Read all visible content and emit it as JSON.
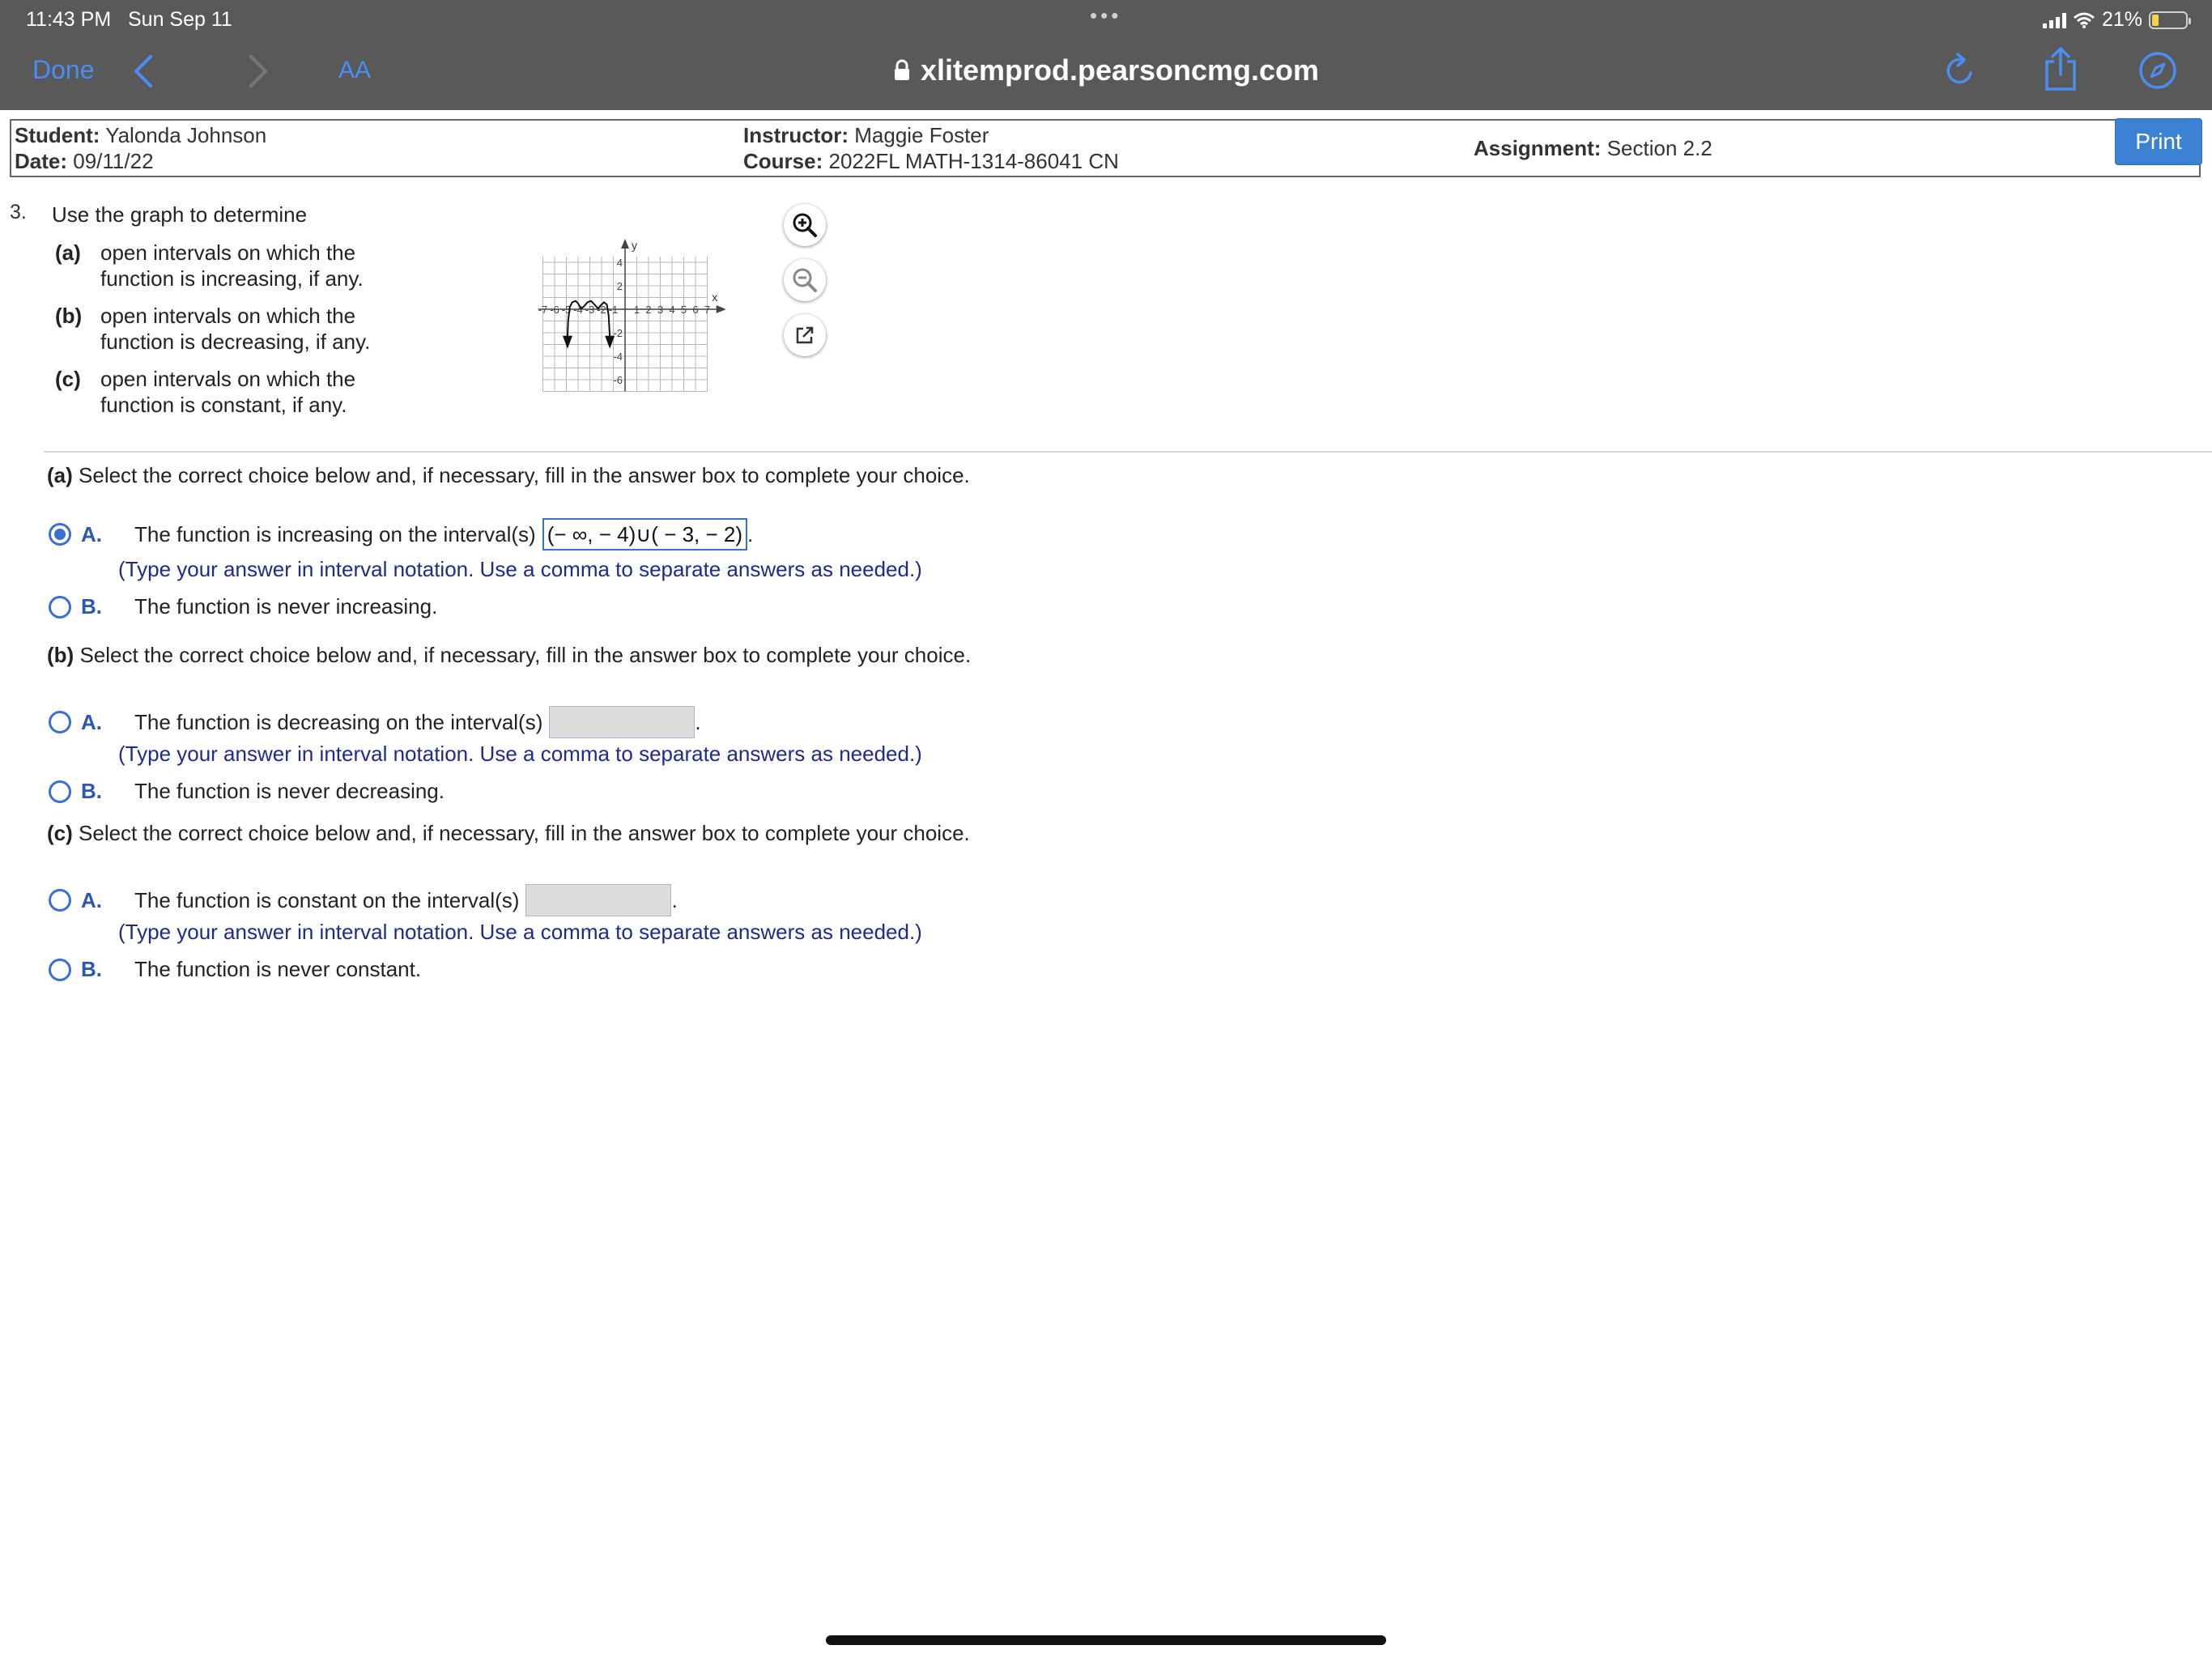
{
  "status_bar": {
    "time": "11:43 PM",
    "date": "Sun Sep 11",
    "dots": "•••",
    "battery": "21%",
    "battery_level": 0.21
  },
  "browser": {
    "done_label": "Done",
    "text_size_label": "AA",
    "url": "xlitemprod.pearsoncmg.com",
    "accent": "#4a8ef2"
  },
  "header": {
    "student_label": "Student:",
    "student": "Yalonda Johnson",
    "date_label": "Date:",
    "date": "09/11/22",
    "instructor_label": "Instructor:",
    "instructor": "Maggie Foster",
    "course_label": "Course:",
    "course": "2022FL MATH-1314-86041 CN",
    "assignment_label": "Assignment:",
    "assignment": "Section 2.2",
    "print_label": "Print"
  },
  "question": {
    "number": "3.",
    "prompt": "Use the graph to determine",
    "items": [
      {
        "label": "(a)",
        "text": "open intervals on which the function is increasing, if any."
      },
      {
        "label": "(b)",
        "text": "open intervals on which the function is decreasing, if any."
      },
      {
        "label": "(c)",
        "text": "open intervals on which the function is constant, if any."
      }
    ],
    "graph": {
      "x_label": "x",
      "y_label": "y",
      "x_ticks": [
        "-7",
        "-6",
        "-5",
        "-4",
        "-3",
        "-2",
        "-1",
        "1",
        "2",
        "3",
        "4",
        "5",
        "6",
        "7"
      ],
      "y_ticks": [
        "4",
        "2",
        "-2",
        "-4",
        "-6"
      ]
    }
  },
  "parts": [
    {
      "tag": "(a)",
      "prompt": "Select the correct choice below and, if necessary, fill in the answer box to complete your choice.",
      "choice_a_letter": "A.",
      "choice_a_text": "The function is increasing on the interval(s)",
      "answer": "(− ∞, − 4)∪( − 3, − 2)",
      "hint": "(Type your answer in interval notation. Use a comma to separate answers as needed.)",
      "choice_b_letter": "B.",
      "choice_b_text": "The function is never increasing.",
      "selected": "A"
    },
    {
      "tag": "(b)",
      "prompt": "Select the correct choice below and, if necessary, fill in the answer box to complete your choice.",
      "choice_a_letter": "A.",
      "choice_a_text": "The function is decreasing on the interval(s)",
      "answer": "",
      "hint": "(Type your answer in interval notation. Use a comma to separate answers as needed.)",
      "choice_b_letter": "B.",
      "choice_b_text": "The function is never decreasing.",
      "selected": ""
    },
    {
      "tag": "(c)",
      "prompt": "Select the correct choice below and, if necessary, fill in the answer box to complete your choice.",
      "choice_a_letter": "A.",
      "choice_a_text": "The function is constant on the interval(s)",
      "answer": "",
      "hint": "(Type your answer in interval notation. Use a comma to separate answers as needed.)",
      "choice_b_letter": "B.",
      "choice_b_text": "The function is never constant.",
      "selected": ""
    }
  ],
  "icons": {
    "zoom_in": "zoom-in-icon",
    "zoom_out": "zoom-out-icon",
    "popout": "external-link-icon"
  }
}
